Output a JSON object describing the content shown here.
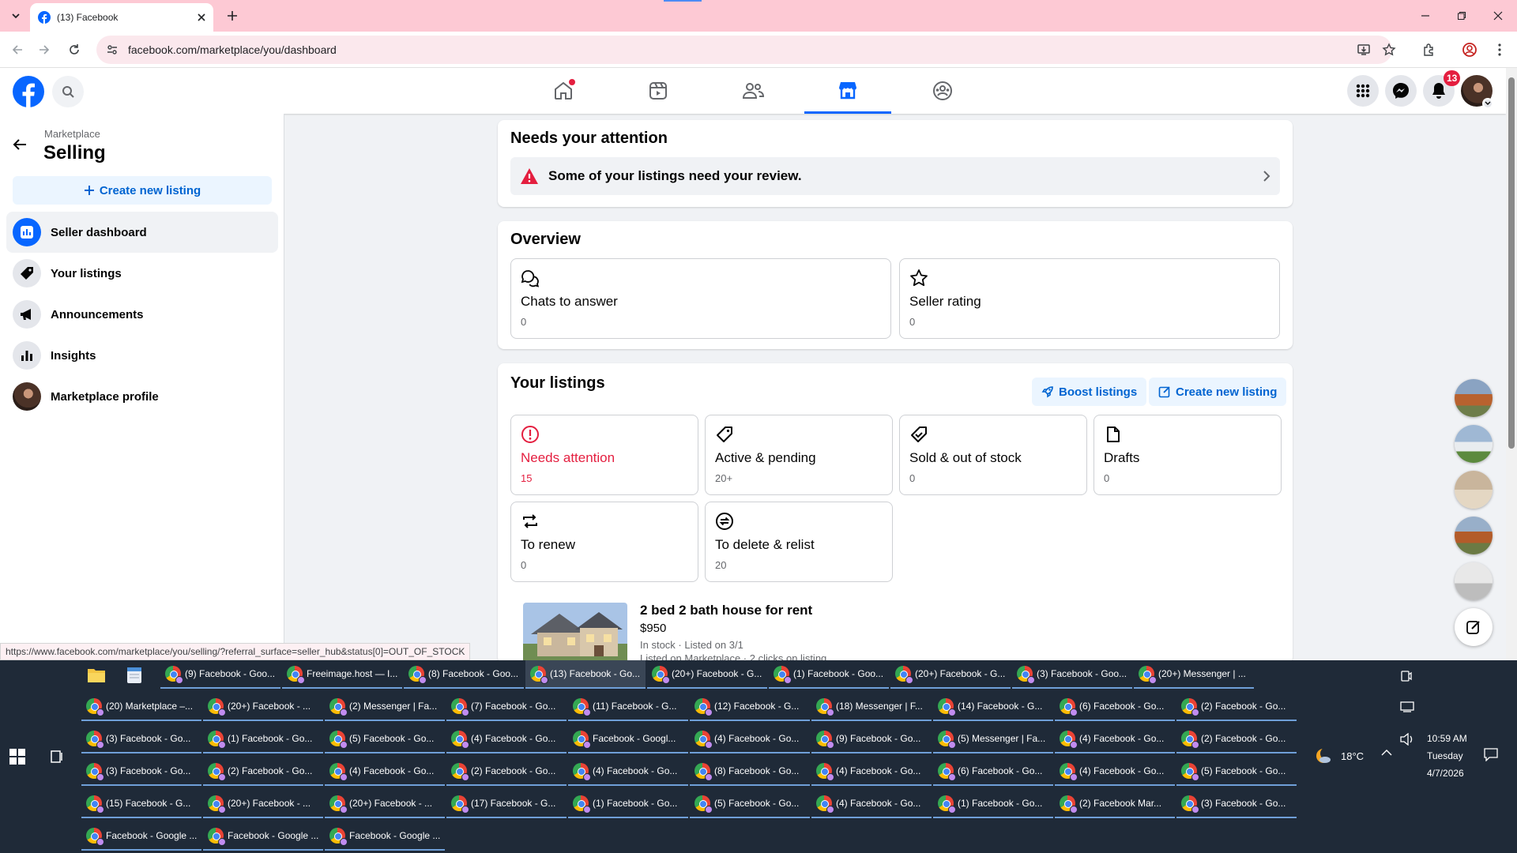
{
  "browser": {
    "tab_title": "(13) Facebook",
    "url": "facebook.com/marketplace/you/dashboard",
    "status_url": "https://www.facebook.com/marketplace/you/selling/?referral_surface=seller_hub&status[0]=OUT_OF_STOCK"
  },
  "header": {
    "notification_count": "13",
    "active_tab": "marketplace"
  },
  "sidebar": {
    "breadcrumb": "Marketplace",
    "title": "Selling",
    "create_label": "Create new listing",
    "items": [
      {
        "label": "Seller dashboard"
      },
      {
        "label": "Your listings"
      },
      {
        "label": "Announcements"
      },
      {
        "label": "Insights"
      },
      {
        "label": "Marketplace profile"
      }
    ]
  },
  "attention": {
    "heading": "Needs your attention",
    "message": "Some of your listings need your review."
  },
  "overview": {
    "heading": "Overview",
    "tiles": [
      {
        "label": "Chats to answer",
        "value": "0"
      },
      {
        "label": "Seller rating",
        "value": "0"
      }
    ]
  },
  "your_listings": {
    "heading": "Your listings",
    "boost_label": "Boost listings",
    "create_label": "Create new listing",
    "tiles": [
      {
        "label": "Needs attention",
        "value": "15"
      },
      {
        "label": "Active & pending",
        "value": "20+"
      },
      {
        "label": "Sold & out of stock",
        "value": "0"
      },
      {
        "label": "Drafts",
        "value": "0"
      },
      {
        "label": "To renew",
        "value": "0"
      },
      {
        "label": "To delete & relist",
        "value": "20"
      }
    ],
    "item": {
      "title": "2 bed 2 bath house for rent",
      "price": "$950",
      "meta1": "In stock · Listed on 3/1",
      "meta2": "Listed on Marketplace · 2 clicks on listing"
    }
  },
  "taskbar": {
    "rows": [
      [
        "(9) Facebook - Goo...",
        "Freeimage.host — I...",
        "(8) Facebook - Goo...",
        "(13) Facebook - Go...",
        "(20+) Facebook - G...",
        "(1) Facebook - Goo...",
        "(20+) Facebook - G...",
        "(3) Facebook - Goo...",
        "(20+) Messenger | ..."
      ],
      [
        "(20) Marketplace –...",
        "(20+) Facebook - ...",
        "(2) Messenger | Fa...",
        "(7) Facebook - Go...",
        "(11) Facebook - G...",
        "(12) Facebook - G...",
        "(18) Messenger | F...",
        "(14) Facebook - G...",
        "(6) Facebook - Go...",
        "(2) Facebook - Go..."
      ],
      [
        "(3) Facebook - Go...",
        "(1) Facebook - Go...",
        "(5) Facebook - Go...",
        "(4) Facebook - Go...",
        "Facebook - Googl...",
        "(4) Facebook - Go...",
        "(9) Facebook - Go...",
        "(5) Messenger | Fa...",
        "(4) Facebook - Go...",
        "(2) Facebook - Go..."
      ],
      [
        "(3) Facebook - Go...",
        "(2) Facebook - Go...",
        "(4) Facebook - Go...",
        "(2) Facebook - Go...",
        "(4) Facebook - Go...",
        "(8) Facebook - Go...",
        "(4) Facebook - Go...",
        "(6) Facebook - Go...",
        "(4) Facebook - Go...",
        "(5) Facebook - Go..."
      ],
      [
        "(15) Facebook - G...",
        "(20+) Facebook - ...",
        "(20+) Facebook - ...",
        "(17) Facebook - G...",
        "(1) Facebook - Go...",
        "(5) Facebook - Go...",
        "(4) Facebook - Go...",
        "(1) Facebook - Go...",
        "(2) Facebook Mar...",
        "(3) Facebook - Go..."
      ],
      [
        "Facebook - Google ...",
        "Facebook - Google ...",
        "Facebook - Google ..."
      ]
    ],
    "weather": "18°C",
    "time": "10:59 AM",
    "day": "Tuesday",
    "date": "4/7/2026"
  },
  "colors": {
    "accent": "#0866ff",
    "alert": "#e41e3f",
    "tab_strip": "#fdc9d4",
    "taskbar": "#1f2a38"
  }
}
